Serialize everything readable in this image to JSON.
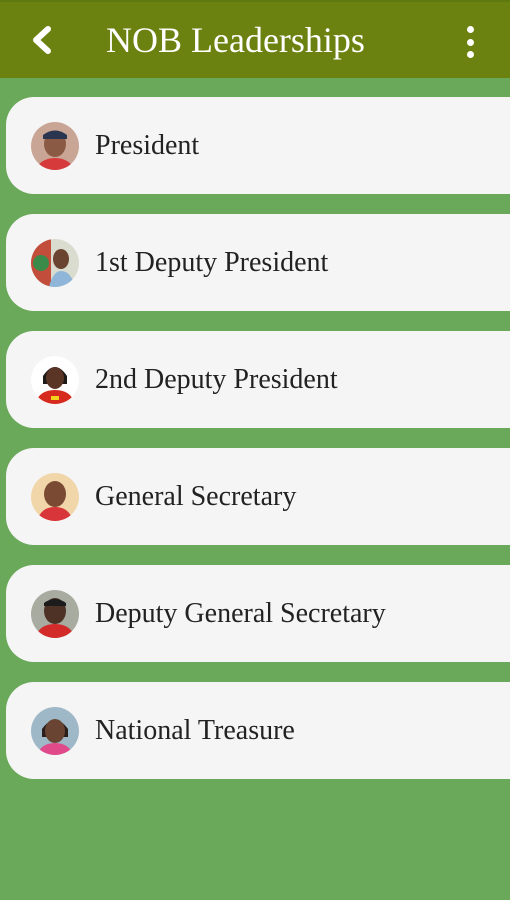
{
  "header": {
    "title": "NOB Leaderships",
    "back_icon": "back-arrow-icon",
    "menu_icon": "more-vertical-icon",
    "bar_color": "#6b8110"
  },
  "background_color": "#6aa85a",
  "leaders": [
    {
      "label": "President"
    },
    {
      "label": "1st Deputy President"
    },
    {
      "label": "2nd Deputy President"
    },
    {
      "label": "General Secretary"
    },
    {
      "label": "Deputy General Secretary"
    },
    {
      "label": "National Treasure"
    }
  ]
}
